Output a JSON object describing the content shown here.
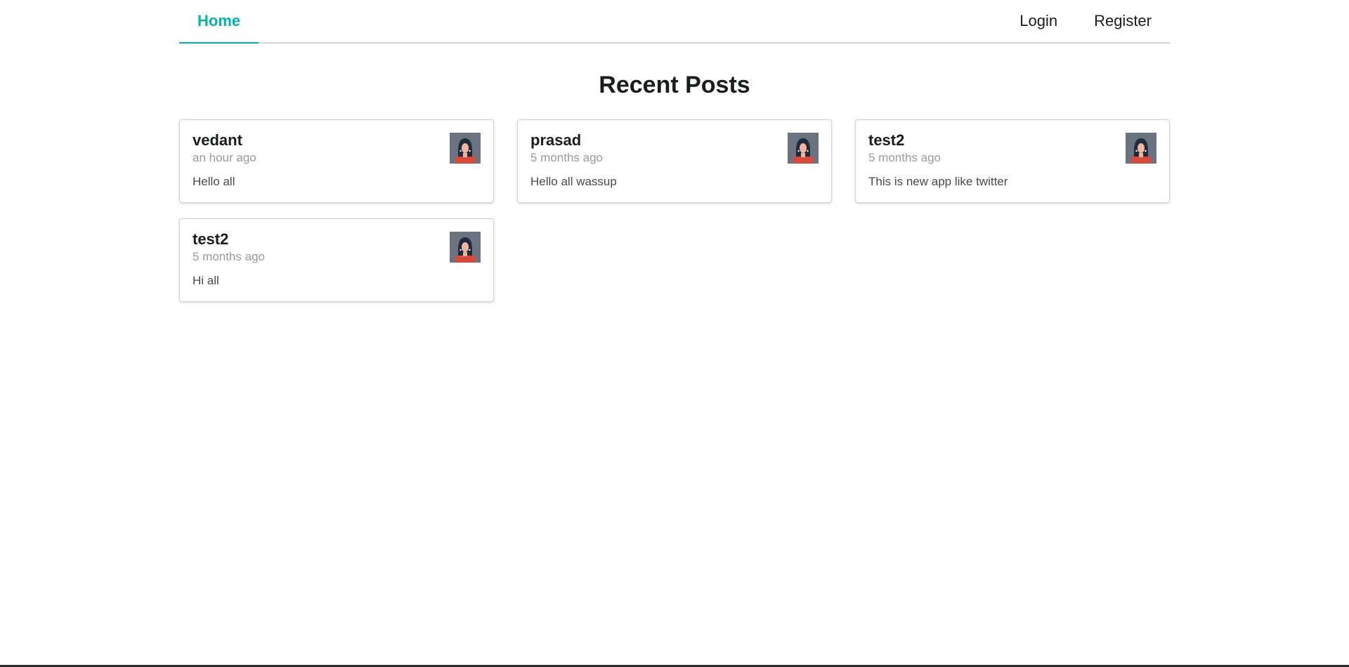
{
  "nav": {
    "home_label": "Home",
    "login_label": "Login",
    "register_label": "Register",
    "accent_color": "#00b5ad"
  },
  "page": {
    "title": "Recent Posts"
  },
  "posts": [
    {
      "author": "vedant",
      "time": "an hour ago",
      "body": "Hello all",
      "avatar_icon": "user-avatar-icon"
    },
    {
      "author": "prasad",
      "time": "5 months ago",
      "body": "Hello all wassup",
      "avatar_icon": "user-avatar-icon"
    },
    {
      "author": "test2",
      "time": "5 months ago",
      "body": "This is new app like twitter",
      "avatar_icon": "user-avatar-icon"
    },
    {
      "author": "test2",
      "time": "5 months ago",
      "body": "Hi all",
      "avatar_icon": "user-avatar-icon"
    }
  ]
}
